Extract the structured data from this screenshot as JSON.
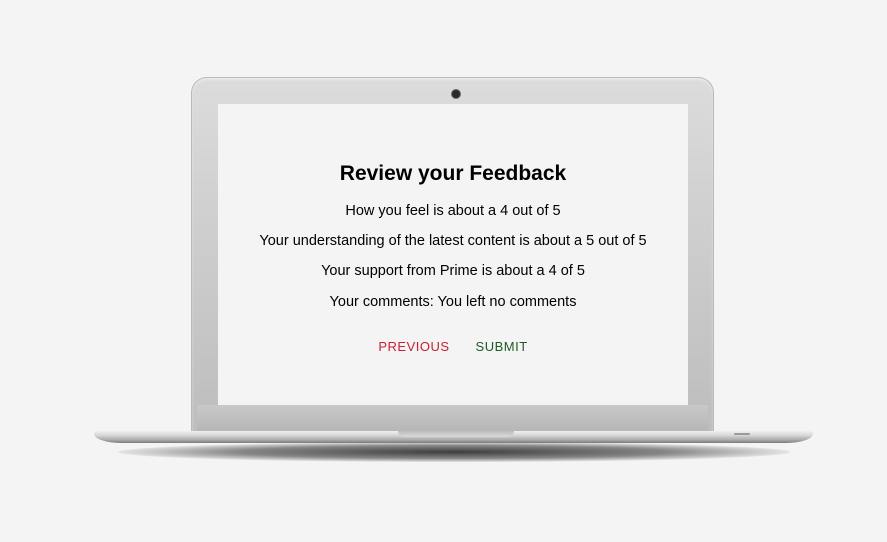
{
  "review": {
    "title": "Review your Feedback",
    "feeling_line": "How you feel is about a 4 out of 5",
    "understanding_line": "Your understanding of the latest content is about a 5 out of 5",
    "support_line": "Your support from Prime is about a 4 of 5",
    "comments_line": "Your comments: You left no comments"
  },
  "actions": {
    "previous_label": "PREVIOUS",
    "submit_label": "SUBMIT"
  },
  "colors": {
    "previous": "#c62233",
    "submit": "#1e5a23",
    "background": "#f4f4f4"
  },
  "icons": {
    "camera": "webcam-icon"
  }
}
